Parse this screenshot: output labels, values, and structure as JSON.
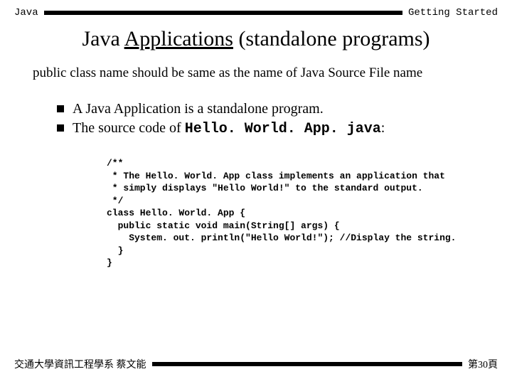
{
  "header": {
    "left": "Java",
    "right": "Getting Started"
  },
  "title": {
    "plain": "Java ",
    "underlined": "Applications",
    "rest": " (standalone programs)"
  },
  "subtitle": "public class name should be same as the name of Java Source File name",
  "bullets": {
    "b1": "A Java Application is a standalone program.",
    "b2_pre": "The source code of ",
    "b2_code": "Hello. World. App. java",
    "b2_post": ":"
  },
  "code": "/**\n * The Hello. World. App class implements an application that\n * simply displays \"Hello World!\" to the standard output.\n */\nclass Hello. World. App {\n  public static void main(String[] args) {\n    System. out. println(\"Hello World!\"); //Display the string.\n  }\n}",
  "footer": {
    "left": "交通大學資訊工程學系 蔡文能",
    "right": "第30頁"
  }
}
